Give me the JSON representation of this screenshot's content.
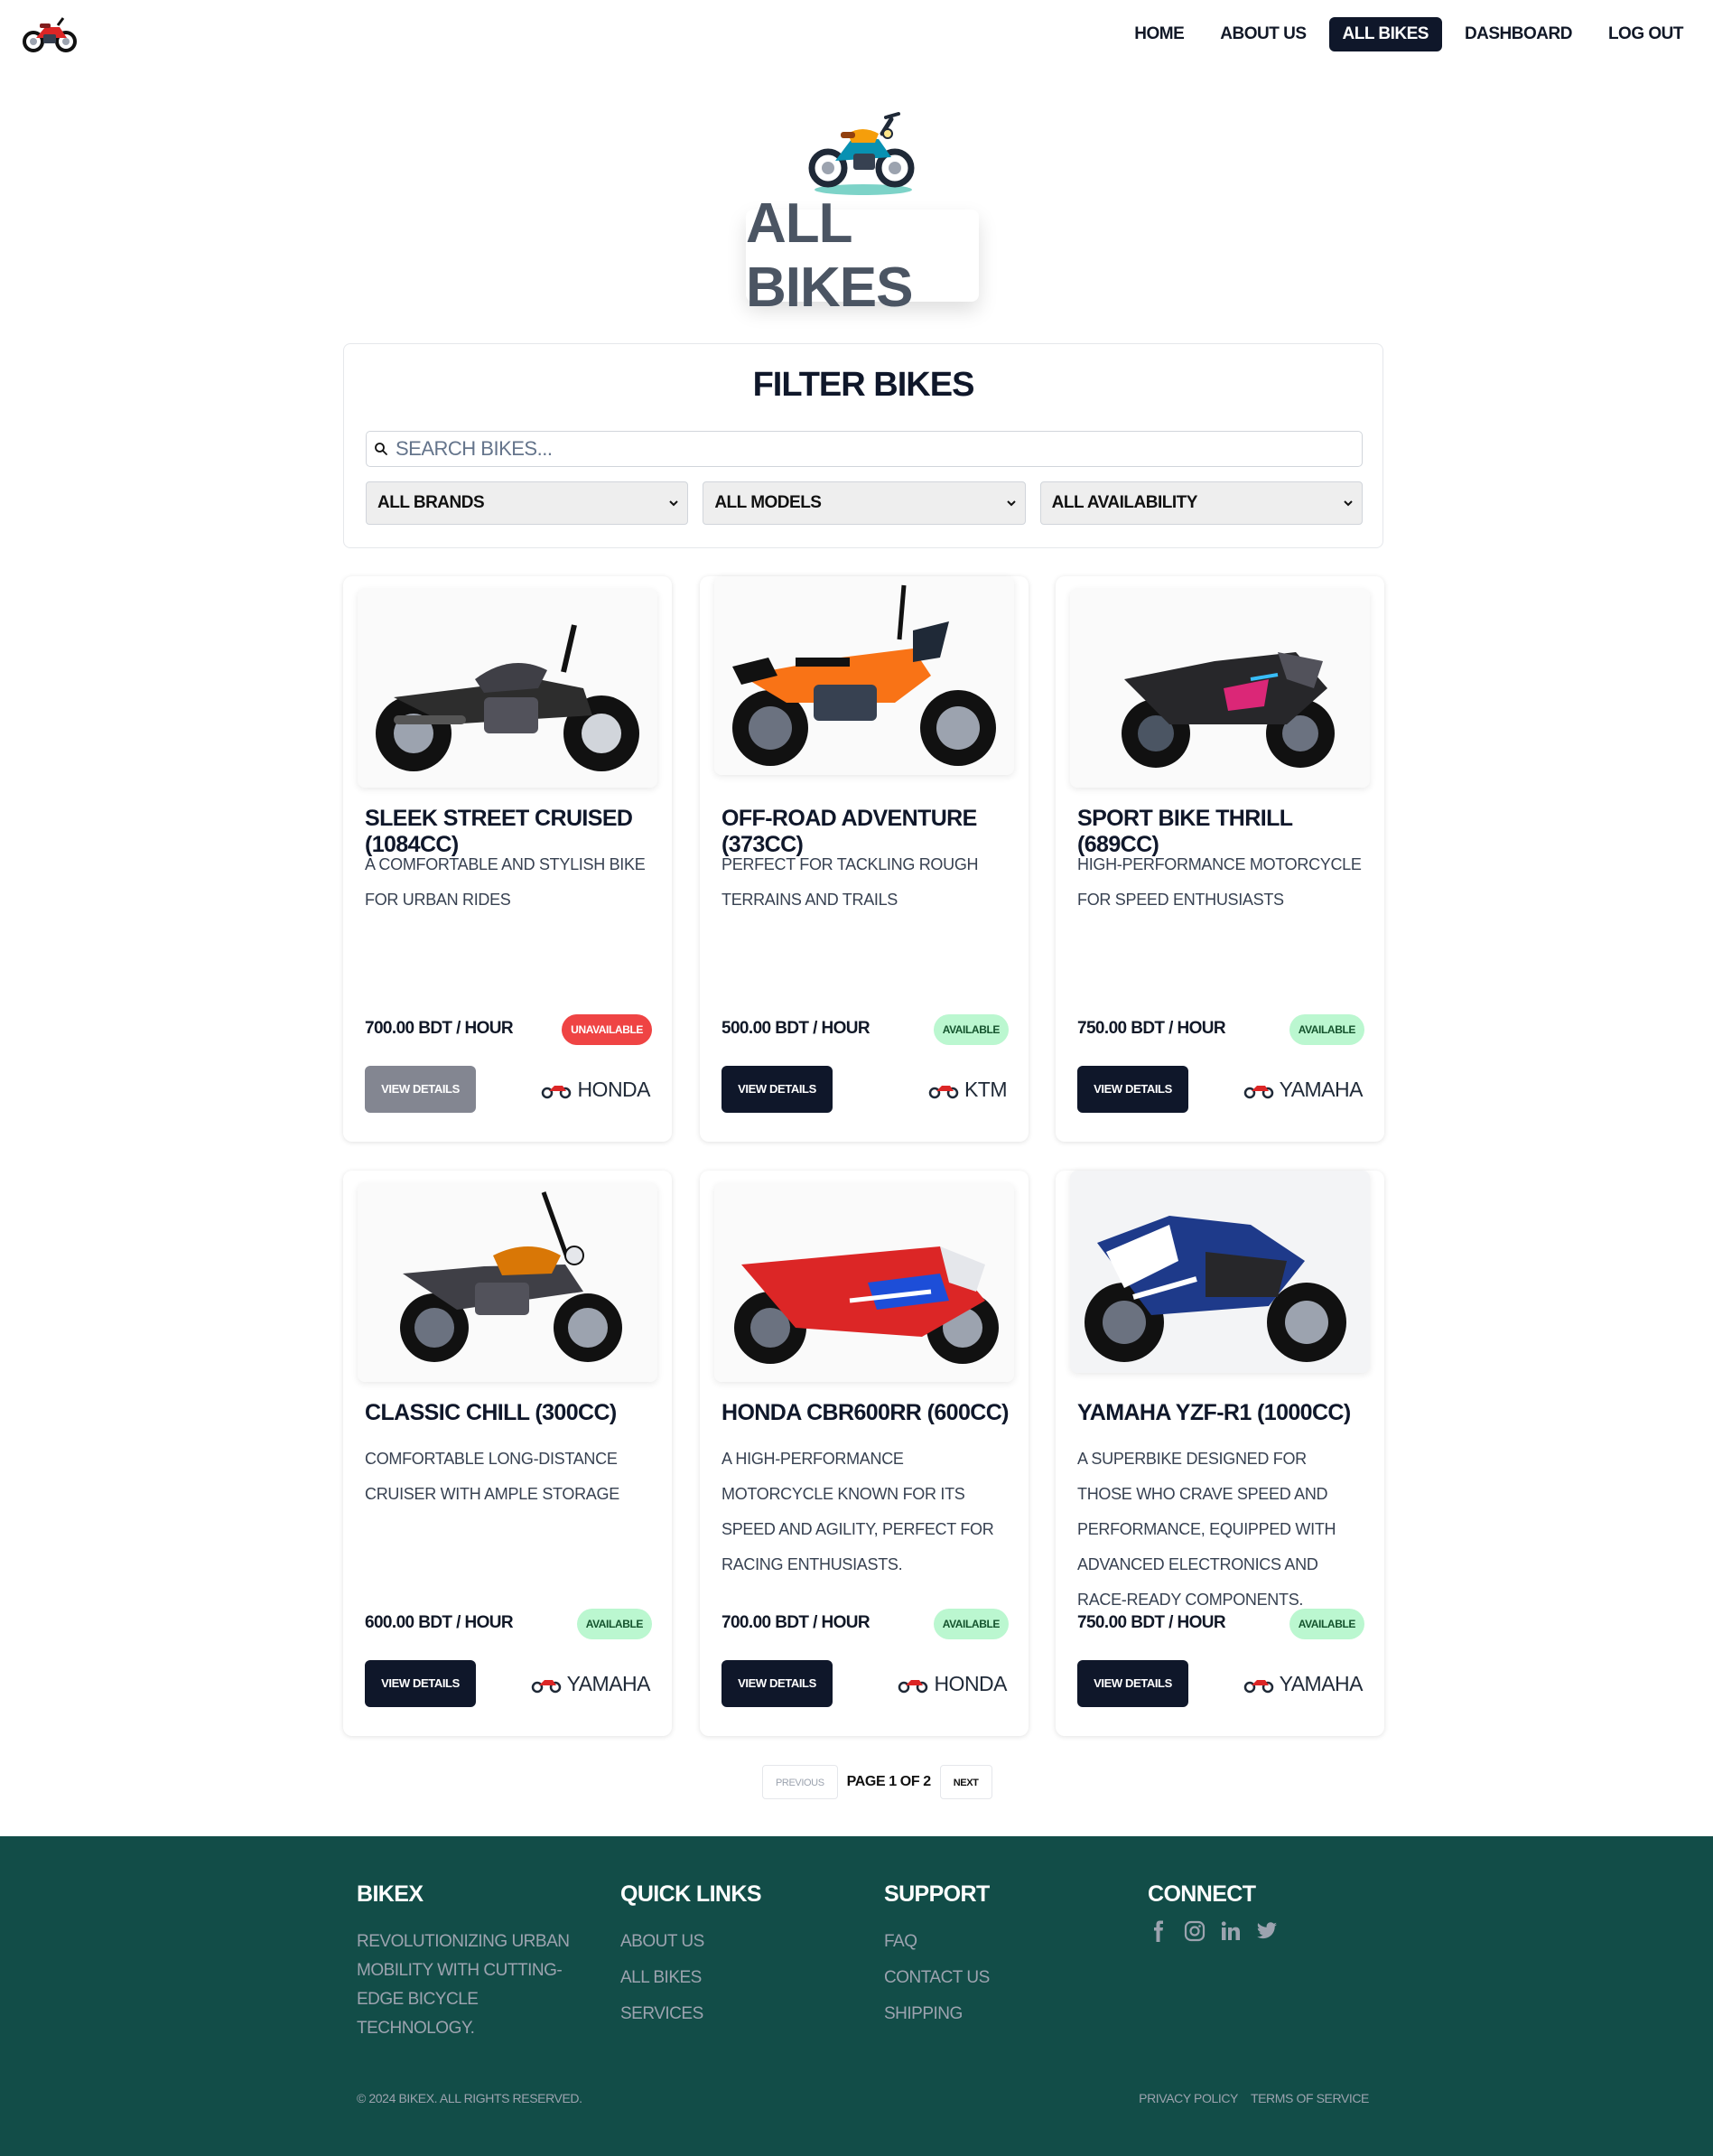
{
  "nav": {
    "logo_icon": "motorcycle-logo-icon",
    "links": [
      {
        "label": "Home",
        "active": false
      },
      {
        "label": "About Us",
        "active": false
      },
      {
        "label": "All Bikes",
        "active": true
      },
      {
        "label": "Dashboard",
        "active": false
      },
      {
        "label": "Log Out",
        "active": false
      }
    ]
  },
  "hero": {
    "icon": "motorcycle-illustration-icon",
    "title": "All Bikes"
  },
  "filter": {
    "title": "Filter Bikes",
    "search_placeholder": "Search bikes...",
    "selects": [
      "All Brands",
      "All Models",
      "All Availability"
    ]
  },
  "bikes": [
    {
      "title": "Sleek Street Cruised (1084cc)",
      "description": "A comfortable and stylish bike for urban rides",
      "price": "700.00 BDT / hour",
      "status": "Unavailable",
      "button": "View Details",
      "button_disabled": true,
      "brand": "Honda"
    },
    {
      "title": "Off-Road Adventure (373cc)",
      "description": "Perfect for tackling rough terrains and trails",
      "price": "500.00 BDT / hour",
      "status": "Available",
      "button": "View Details",
      "button_disabled": false,
      "brand": "KTM"
    },
    {
      "title": "Sport Bike Thrill (689cc)",
      "description": "High-performance motorcycle for speed enthusiasts",
      "price": "750.00 BDT / hour",
      "status": "Available",
      "button": "View Details",
      "button_disabled": false,
      "brand": "Yamaha"
    },
    {
      "title": "Classic Chill (300cc)",
      "description": "Comfortable long-distance cruiser with ample storage",
      "price": "600.00 BDT / hour",
      "status": "Available",
      "button": "View Details",
      "button_disabled": false,
      "brand": "Yamaha"
    },
    {
      "title": "Honda CBR600RR (600cc)",
      "description": "A high-performance motorcycle known for its speed and agility, perfect for racing enthusiasts.",
      "price": "700.00 BDT / hour",
      "status": "Available",
      "button": "View Details",
      "button_disabled": false,
      "brand": "Honda"
    },
    {
      "title": "Yamaha YZF-R1 (1000cc)",
      "description": "A superbike designed for those who crave speed and performance, equipped with advanced electronics and race-ready components.",
      "price": "750.00 BDT / hour",
      "status": "Available",
      "button": "View Details",
      "button_disabled": false,
      "brand": "Yamaha"
    }
  ],
  "pagination": {
    "previous": "Previous",
    "page_text": "Page 1 of 2",
    "next": "Next"
  },
  "footer": {
    "brand": "BikeX",
    "tagline": "Revolutionizing urban mobility with cutting-edge bicycle technology.",
    "quick_links_title": "Quick Links",
    "quick_links": [
      "About Us",
      "All Bikes",
      "Services"
    ],
    "support_title": "Support",
    "support_links": [
      "FAQ",
      "Contact Us",
      "Shipping"
    ],
    "connect_title": "Connect",
    "socials": [
      "facebook-icon",
      "instagram-icon",
      "linkedin-icon",
      "twitter-icon"
    ],
    "copyright": "© 2024 BikeX. All rights reserved.",
    "legal_links": [
      "Privacy Policy",
      "Terms of Service"
    ]
  },
  "colors": {
    "primary": "#0f172a",
    "footer_bg": "#124d48",
    "available_bg": "#bbf7d0",
    "unavailable_bg": "#ef4444"
  }
}
